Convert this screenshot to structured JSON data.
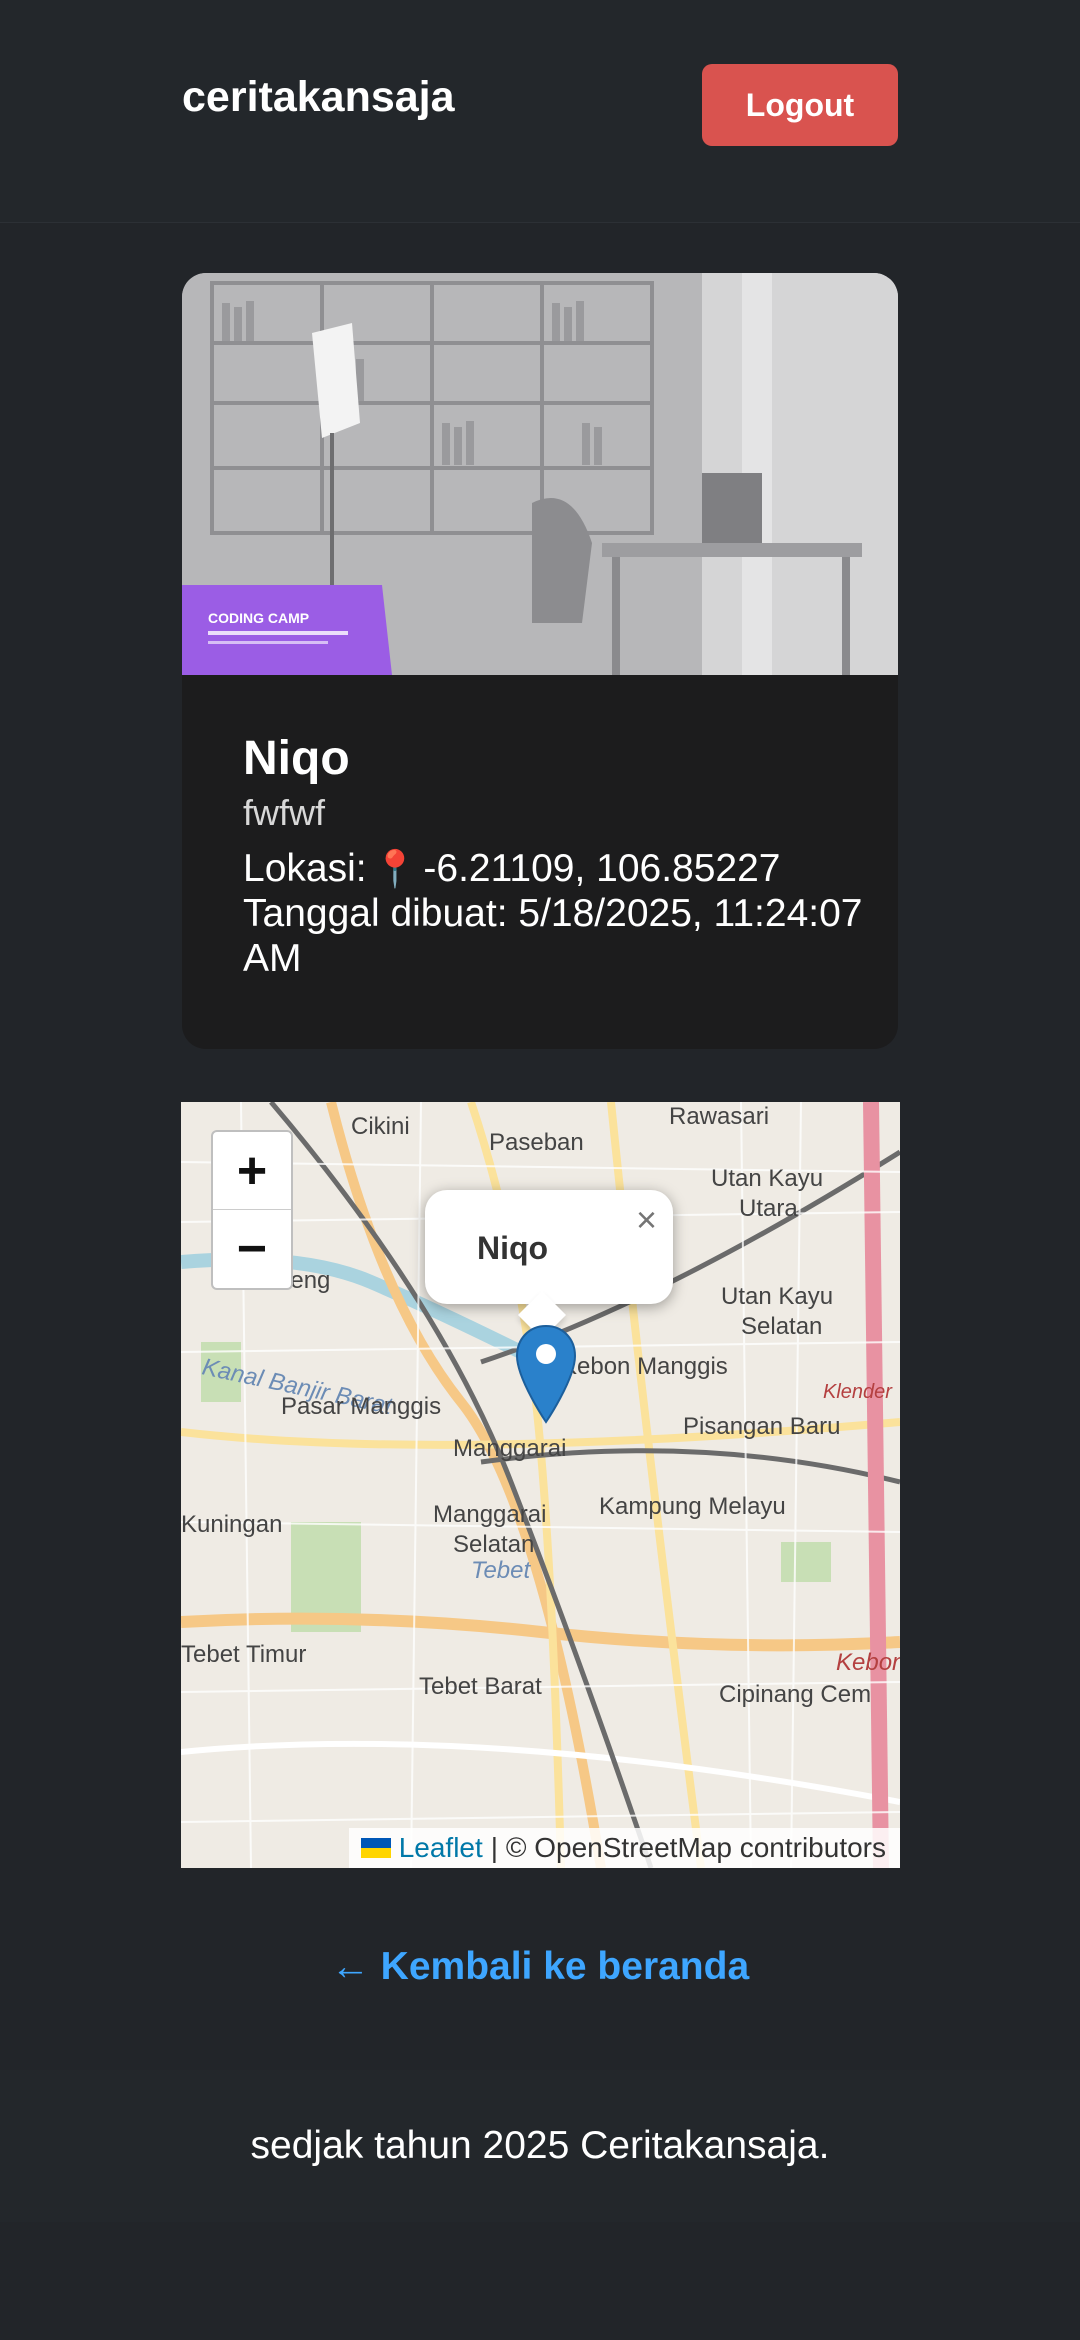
{
  "header": {
    "brand": "ceritakansaja",
    "logout_label": "Logout"
  },
  "story": {
    "image_badge": "CODING CAMP",
    "title": "Niqo",
    "description": "fwfwf",
    "location_label": "Lokasi:",
    "location_value": "-6.21109, 106.85227",
    "date_label": "Tanggal dibuat:",
    "date_value": "5/18/2025, 11:24:07 AM"
  },
  "map": {
    "zoom_in": "+",
    "zoom_out": "−",
    "popup_title": "Niqo",
    "popup_close": "×",
    "attribution_link": "Leaflet",
    "attribution_rest": "| © OpenStreetMap contributors",
    "labels": {
      "rawasari": "Rawasari",
      "cikini": "Cikini",
      "paseban": "Paseban",
      "utan_kayu_utara_1": "Utan Kayu",
      "utan_kayu_utara_2": "Utara",
      "utan_kayu_selatan_1": "Utan Kayu",
      "utan_kayu_selatan_2": "Selatan",
      "menteng": "Menteng",
      "banjir": "Kanal Banjir Barat",
      "kebon_manggis": "Kebon Manggis",
      "pasar_manggis": "Pasar Manggis",
      "manggarai": "Manggarai",
      "pisangan_baru": "Pisangan Baru",
      "kuningan": "Kuningan",
      "manggarai_selatan_1": "Manggarai",
      "manggarai_selatan_2": "Selatan",
      "kampung_melayu": "Kampung Melayu",
      "tebet": "Tebet",
      "tebet_timur": "Tebet Timur",
      "tebet_barat": "Tebet Barat",
      "cipinang": "Cipinang Cem",
      "kebon": "Kebon",
      "klender": "Klender"
    }
  },
  "back_link": "← Kembali ke beranda",
  "footer": {
    "text": "sedjak tahun 2025 Ceritakansaja."
  },
  "colors": {
    "background": "#222529",
    "header": "#23272b",
    "logout": "#d9534f",
    "link": "#3ea6ff",
    "marker": "#2a81cb"
  }
}
